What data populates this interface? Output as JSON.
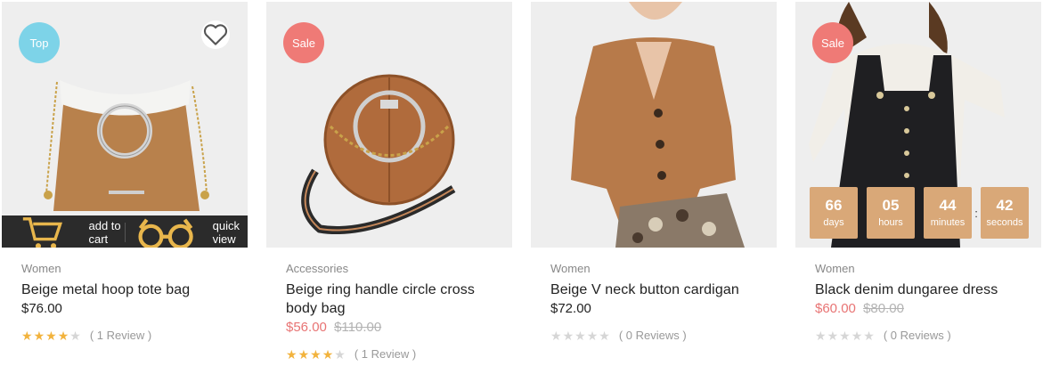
{
  "products": [
    {
      "category": "Women",
      "name": "Beige metal hoop tote bag",
      "price": "$76.00",
      "old_price": "",
      "badge": "Top",
      "rating": 4,
      "review_text": "( 1 Review )",
      "image": "tan-suede-tote-bag-with-white-trim-and-metal-hoop"
    },
    {
      "category": "Accessories",
      "name": "Beige ring handle circle cross body bag",
      "price": "$56.00",
      "old_price": "$110.00",
      "badge": "Sale",
      "rating": 4,
      "review_text": "( 1 Review )",
      "image": "round-tan-crossbody-bag-with-chain-and-ring-handle"
    },
    {
      "category": "Women",
      "name": "Beige V neck button cardigan",
      "price": "$72.00",
      "old_price": "",
      "badge": "",
      "rating": 0,
      "review_text": "( 0 Reviews )",
      "image": "model-in-tan-knit-cardigan-and-snakeskin-skirt"
    },
    {
      "category": "Women",
      "name": "Black denim dungaree dress",
      "price": "$60.00",
      "old_price": "$80.00",
      "badge": "Sale",
      "rating": 0,
      "review_text": "( 0 Reviews )",
      "image": "model-in-black-denim-dungaree-dress-and-white-top"
    }
  ],
  "hover_actions": {
    "add_to_cart": "add to cart",
    "quick_view": "quick view"
  },
  "countdown": [
    {
      "value": "66",
      "label": "days"
    },
    {
      "value": "05",
      "label": "hours"
    },
    {
      "value": "44",
      "label": "minutes"
    },
    {
      "value": "42",
      "label": "seconds"
    }
  ],
  "colors": {
    "badge_top": "#7dd3e8",
    "badge_sale": "#ef7a76",
    "sale_price": "#e87474",
    "star_on": "#f2b33d",
    "star_off": "#d6d6d6",
    "countdown_bg": "#d9a878",
    "action_bar": "#2b2b2b"
  },
  "icons": [
    "heart-icon",
    "cart-icon",
    "glasses-icon",
    "star-icon"
  ]
}
